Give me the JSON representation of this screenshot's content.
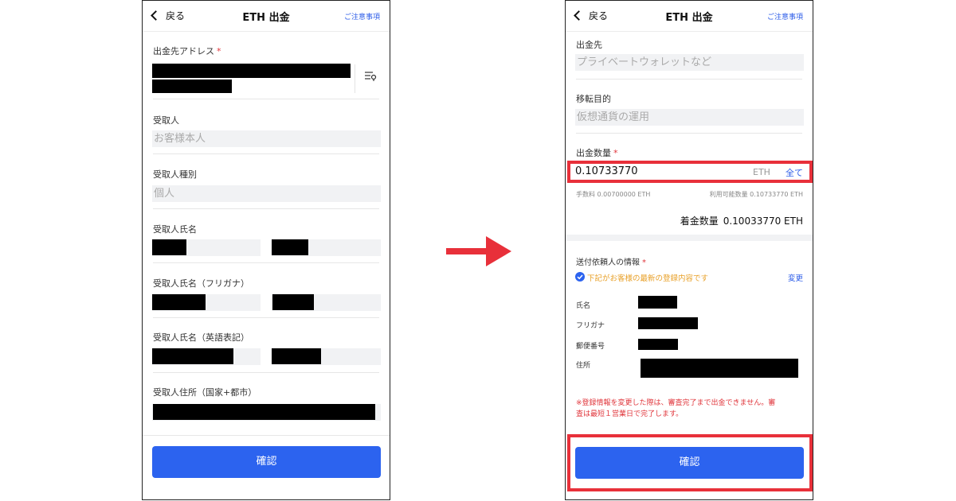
{
  "left": {
    "header": {
      "back_label": "戻る",
      "title": "ETH 出金",
      "notice": "ご注意事項"
    },
    "fields": {
      "address_label": "出金先アドレス",
      "required_mark": "*",
      "recipient_label": "受取人",
      "recipient_value": "お客様本人",
      "recipient_type_label": "受取人種別",
      "recipient_type_value": "個人",
      "recipient_name_label": "受取人氏名",
      "recipient_kana_label": "受取人氏名（フリガナ）",
      "recipient_en_label": "受取人氏名（英語表記）",
      "recipient_address_label": "受取人住所（国家+都市）"
    },
    "confirm_label": "確認"
  },
  "right": {
    "header": {
      "back_label": "戻る",
      "title": "ETH 出金",
      "notice": "ご注意事項"
    },
    "destination_label": "出金先",
    "destination_placeholder": "プライベートウォレットなど",
    "purpose_label": "移転目的",
    "purpose_placeholder": "仮想通貨の運用",
    "amount_label": "出金数量",
    "required_mark": "*",
    "amount_value": "0.10733770",
    "amount_unit": "ETH",
    "all_label": "全て",
    "fee_text": "手数料 0.00700000 ETH",
    "available_text": "利用可能数量 0.10733770 ETH",
    "received_label": "着金数量",
    "received_value": "0.10033770 ETH",
    "sender_info_label": "送付依頼人の情報",
    "registered_note": "下記がお客様の最新の登録内容です",
    "change_label": "変更",
    "rows": {
      "name": "氏名",
      "kana": "フリガナ",
      "postal": "郵便番号",
      "address": "住所"
    },
    "warning_line1": "※登録情報を変更した際は、審査完了まで出金できません。審",
    "warning_line2": "査は最短１営業日で完了します。",
    "confirm_label": "確認"
  },
  "colors": {
    "accent": "#2c63ef",
    "highlight_red": "#e8303a",
    "warning_orange": "#e8a028"
  }
}
